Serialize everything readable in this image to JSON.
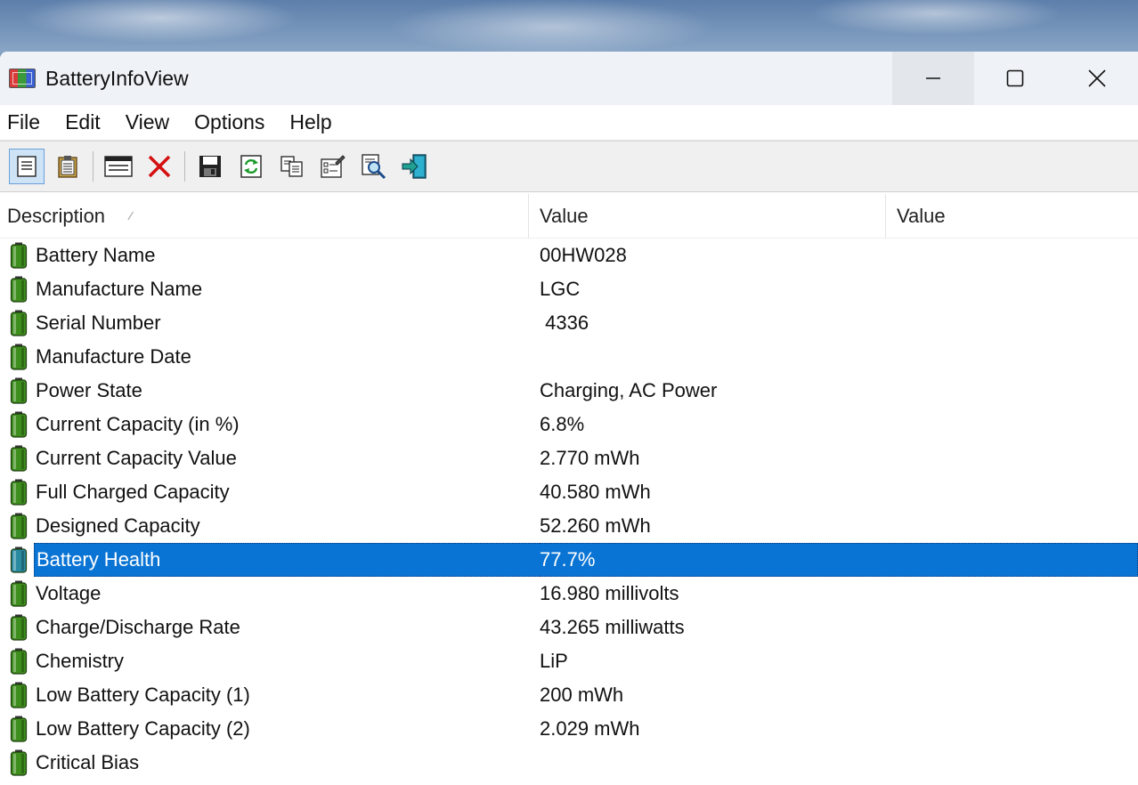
{
  "window": {
    "title": "BatteryInfoView",
    "controls": {
      "minimize": "—",
      "maximize": "☐",
      "close": "✕"
    }
  },
  "menu": [
    "File",
    "Edit",
    "View",
    "Options",
    "Help"
  ],
  "toolbar": {
    "buttons": [
      "html-report-icon",
      "clipboard-icon",
      "properties-window-icon",
      "delete-icon",
      "save-icon",
      "refresh-icon",
      "copy-icon",
      "properties-icon",
      "find-icon",
      "exit-icon"
    ]
  },
  "columns": {
    "description": "Description",
    "value": "Value",
    "value2": "Value",
    "sort_indicator": "⁄"
  },
  "rows": [
    {
      "description": "Battery Name",
      "value": "00HW028"
    },
    {
      "description": "Manufacture Name",
      "value": "LGC"
    },
    {
      "description": "Serial Number",
      "value": " 4336"
    },
    {
      "description": "Manufacture Date",
      "value": ""
    },
    {
      "description": "Power State",
      "value": "Charging, AC Power"
    },
    {
      "description": "Current Capacity (in %)",
      "value": "6.8%"
    },
    {
      "description": "Current Capacity Value",
      "value": "2.770 mWh"
    },
    {
      "description": "Full Charged Capacity",
      "value": "40.580 mWh"
    },
    {
      "description": "Designed Capacity",
      "value": "52.260 mWh"
    },
    {
      "description": "Battery Health",
      "value": "77.7%",
      "selected": true
    },
    {
      "description": "Voltage",
      "value": "16.980 millivolts"
    },
    {
      "description": "Charge/Discharge Rate",
      "value": "43.265 milliwatts"
    },
    {
      "description": "Chemistry",
      "value": "LiP"
    },
    {
      "description": "Low Battery Capacity (1)",
      "value": "200 mWh"
    },
    {
      "description": "Low Battery Capacity (2)",
      "value": "2.029 mWh"
    },
    {
      "description": "Critical Bias",
      "value": ""
    }
  ],
  "colors": {
    "selection": "#0a74d4",
    "battery_green": "#3e8e1e",
    "battery_selected": "#2a8aa0"
  }
}
